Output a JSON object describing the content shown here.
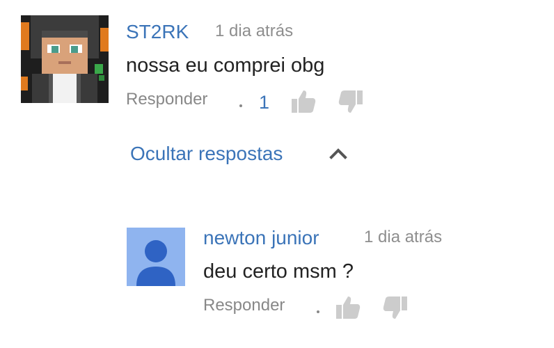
{
  "comment": {
    "author": "ST2RK",
    "time": "1 dia atrás",
    "text": "nossa eu comprei obg",
    "reply_label": "Responder",
    "separator": "·",
    "like_count": "1"
  },
  "replies_toggle": {
    "label": "Ocultar respostas"
  },
  "reply": {
    "author": "newton junior",
    "time": "1 dia atrás",
    "text": "deu certo msm ?",
    "reply_label": "Responder",
    "separator": "·"
  },
  "colors": {
    "link_blue": "#3b74b8",
    "muted_gray": "#888888",
    "icon_gray": "#cccccc",
    "default_avatar_bg": "#8fb4ef",
    "default_avatar_fg": "#2f63c4"
  }
}
